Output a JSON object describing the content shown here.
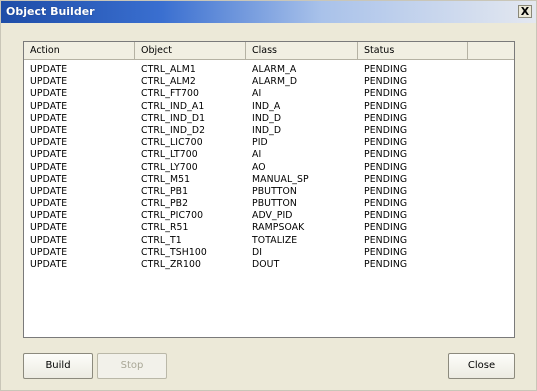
{
  "window": {
    "title": "Object Builder",
    "close_symbol": "X"
  },
  "columns": [
    "Action",
    "Object",
    "Class",
    "Status"
  ],
  "rows": [
    [
      "UPDATE",
      "CTRL_ALM1",
      "ALARM_A",
      "PENDING"
    ],
    [
      "UPDATE",
      "CTRL_ALM2",
      "ALARM_D",
      "PENDING"
    ],
    [
      "UPDATE",
      "CTRL_FT700",
      "AI",
      "PENDING"
    ],
    [
      "UPDATE",
      "CTRL_IND_A1",
      "IND_A",
      "PENDING"
    ],
    [
      "UPDATE",
      "CTRL_IND_D1",
      "IND_D",
      "PENDING"
    ],
    [
      "UPDATE",
      "CTRL_IND_D2",
      "IND_D",
      "PENDING"
    ],
    [
      "UPDATE",
      "CTRL_LIC700",
      "PID",
      "PENDING"
    ],
    [
      "UPDATE",
      "CTRL_LT700",
      "AI",
      "PENDING"
    ],
    [
      "UPDATE",
      "CTRL_LY700",
      "AO",
      "PENDING"
    ],
    [
      "UPDATE",
      "CTRL_M51",
      "MANUAL_SP",
      "PENDING"
    ],
    [
      "UPDATE",
      "CTRL_PB1",
      "PBUTTON",
      "PENDING"
    ],
    [
      "UPDATE",
      "CTRL_PB2",
      "PBUTTON",
      "PENDING"
    ],
    [
      "UPDATE",
      "CTRL_PIC700",
      "ADV_PID",
      "PENDING"
    ],
    [
      "UPDATE",
      "CTRL_R51",
      "RAMPSOAK",
      "PENDING"
    ],
    [
      "UPDATE",
      "CTRL_T1",
      "TOTALIZE",
      "PENDING"
    ],
    [
      "UPDATE",
      "CTRL_TSH100",
      "DI",
      "PENDING"
    ],
    [
      "UPDATE",
      "CTRL_ZR100",
      "DOUT",
      "PENDING"
    ]
  ],
  "buttons": {
    "build": "Build",
    "stop": "Stop",
    "close": "Close"
  },
  "colors": {
    "titlebar_start": "#1e4da8",
    "window_bg": "#ece9d8"
  }
}
